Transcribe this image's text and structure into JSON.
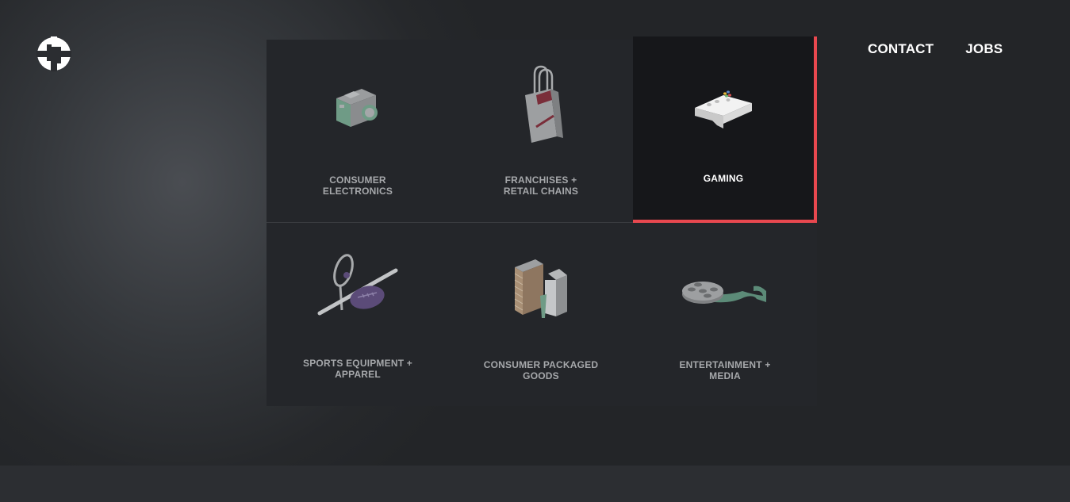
{
  "nav": {
    "contact_label": "CONTACT",
    "jobs_label": "JOBS"
  },
  "tiles": [
    {
      "label": "CONSUMER\nELECTRONICS",
      "icon": "camera-icon"
    },
    {
      "label": "FRANCHISES +\nRETAIL CHAINS",
      "icon": "shopping-bag-icon"
    },
    {
      "label": "GAMING",
      "icon": "game-controller-icon",
      "active": true
    },
    {
      "label": "SPORTS EQUIPMENT +\nAPPAREL",
      "icon": "sports-equipment-icon"
    },
    {
      "label": "CONSUMER PACKAGED\nGOODS",
      "icon": "packaged-goods-icon"
    },
    {
      "label": "ENTERTAINMENT +\nMEDIA",
      "icon": "film-reel-icon"
    }
  ],
  "colors": {
    "accent": "#e8484f",
    "tile_bg": "#24262a",
    "active_tile_bg": "#16171a",
    "label_text": "#a6a8ab",
    "active_label_text": "#ffffff"
  }
}
